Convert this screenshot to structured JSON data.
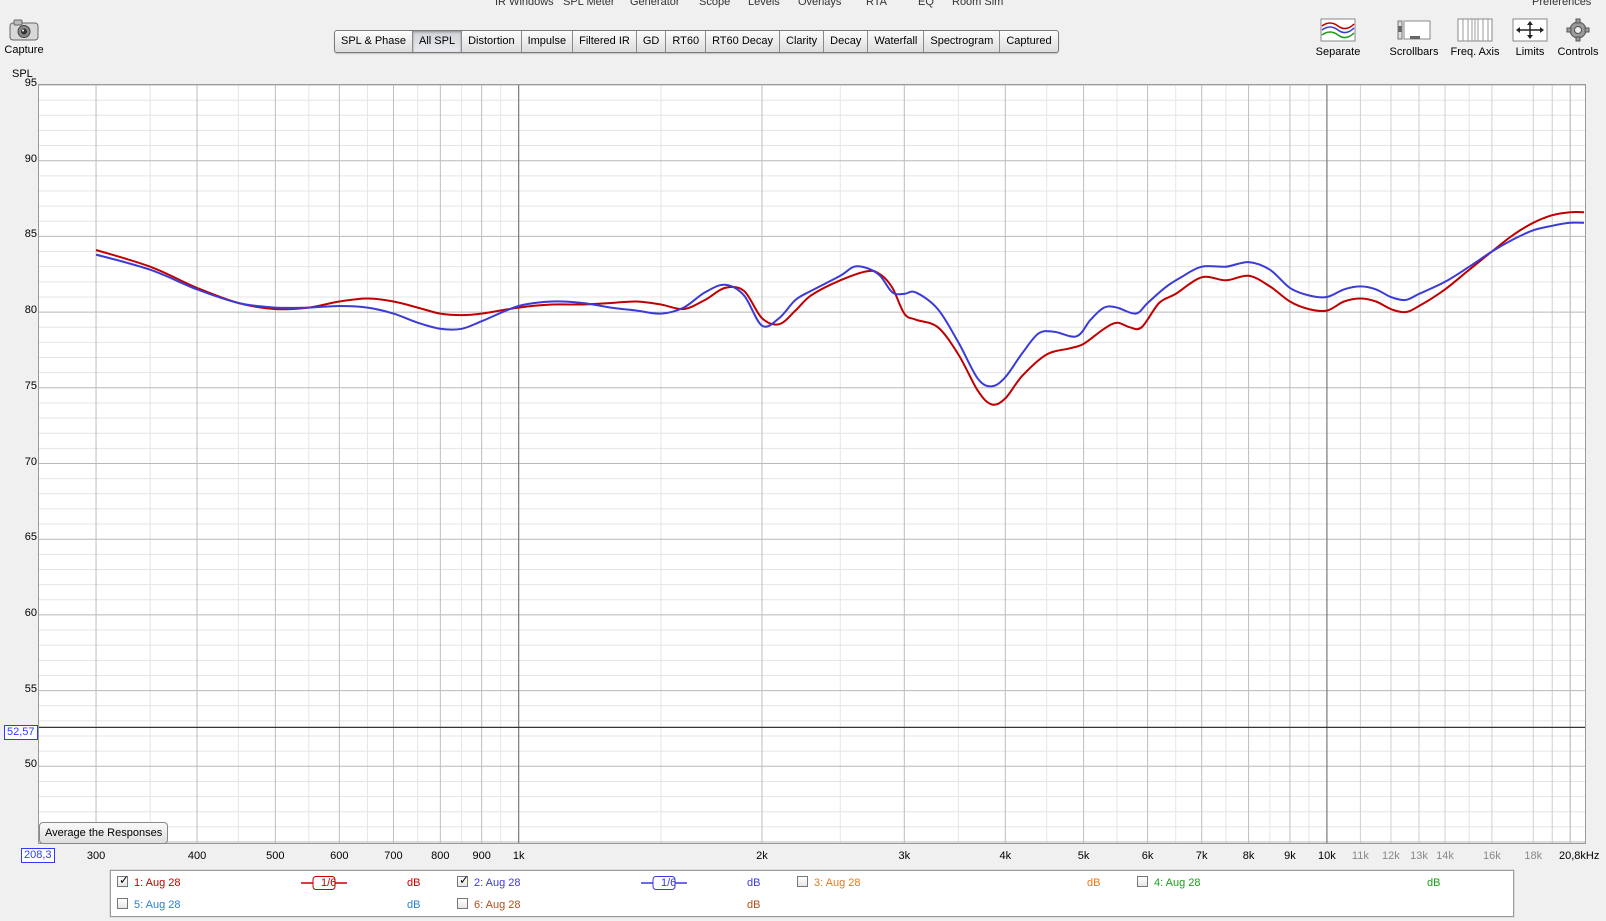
{
  "top_menu": [
    "IR Windows",
    "SPL Meter",
    "Generator",
    "Scope",
    "Levels",
    "Overlays",
    "RTA",
    "EQ",
    "Room Sim",
    "Preferences"
  ],
  "capture": {
    "label": "Capture"
  },
  "tabs": [
    {
      "label": "SPL & Phase",
      "active": false
    },
    {
      "label": "All SPL",
      "active": true
    },
    {
      "label": "Distortion",
      "active": false
    },
    {
      "label": "Impulse",
      "active": false
    },
    {
      "label": "Filtered IR",
      "active": false
    },
    {
      "label": "GD",
      "active": false
    },
    {
      "label": "RT60",
      "active": false
    },
    {
      "label": "RT60 Decay",
      "active": false
    },
    {
      "label": "Clarity",
      "active": false
    },
    {
      "label": "Decay",
      "active": false
    },
    {
      "label": "Waterfall",
      "active": false
    },
    {
      "label": "Spectrogram",
      "active": false
    },
    {
      "label": "Captured",
      "active": false
    }
  ],
  "right_tools": [
    {
      "label": "Separate",
      "icon": "separate-icon"
    },
    {
      "label": "Scrollbars",
      "icon": "scrollbars-icon"
    },
    {
      "label": "Freq. Axis",
      "icon": "freq-axis-icon"
    },
    {
      "label": "Limits",
      "icon": "limits-icon"
    },
    {
      "label": "Controls",
      "icon": "gear-icon"
    }
  ],
  "avg_button": "Average the Responses",
  "cursor": {
    "y_value": "52,57",
    "x_value": "208,3",
    "y_numeric": 52.57
  },
  "chart_data": {
    "type": "line",
    "ylabel": "SPL",
    "xscale": "log",
    "xlim": [
      255,
      20800
    ],
    "ylim": [
      45,
      95
    ],
    "y_ticks": [
      95,
      90,
      85,
      80,
      75,
      70,
      65,
      60,
      55,
      50
    ],
    "x_ticks": [
      {
        "v": 300,
        "t": "300",
        "minor": false
      },
      {
        "v": 400,
        "t": "400",
        "minor": false
      },
      {
        "v": 500,
        "t": "500",
        "minor": false
      },
      {
        "v": 600,
        "t": "600",
        "minor": false
      },
      {
        "v": 700,
        "t": "700",
        "minor": false
      },
      {
        "v": 800,
        "t": "800",
        "minor": false
      },
      {
        "v": 900,
        "t": "900",
        "minor": false
      },
      {
        "v": 1000,
        "t": "1k",
        "minor": false
      },
      {
        "v": 2000,
        "t": "2k",
        "minor": false
      },
      {
        "v": 3000,
        "t": "3k",
        "minor": false
      },
      {
        "v": 4000,
        "t": "4k",
        "minor": false
      },
      {
        "v": 5000,
        "t": "5k",
        "minor": false
      },
      {
        "v": 6000,
        "t": "6k",
        "minor": false
      },
      {
        "v": 7000,
        "t": "7k",
        "minor": false
      },
      {
        "v": 8000,
        "t": "8k",
        "minor": false
      },
      {
        "v": 9000,
        "t": "9k",
        "minor": false
      },
      {
        "v": 10000,
        "t": "10k",
        "minor": false
      },
      {
        "v": 11000,
        "t": "11k",
        "minor": true
      },
      {
        "v": 12000,
        "t": "12k",
        "minor": true
      },
      {
        "v": 13000,
        "t": "13k",
        "minor": true
      },
      {
        "v": 14000,
        "t": "14k",
        "minor": true
      },
      {
        "v": 16000,
        "t": "16k",
        "minor": true
      },
      {
        "v": 18000,
        "t": "18k",
        "minor": true
      },
      {
        "v": 20800,
        "t": "20,8kHz",
        "minor": false
      }
    ],
    "series": [
      {
        "name": "1: Aug 28",
        "color": "#c00000",
        "points": [
          [
            300,
            84.1
          ],
          [
            350,
            83.0
          ],
          [
            400,
            81.6
          ],
          [
            450,
            80.6
          ],
          [
            500,
            80.2
          ],
          [
            550,
            80.3
          ],
          [
            600,
            80.7
          ],
          [
            650,
            80.9
          ],
          [
            700,
            80.7
          ],
          [
            750,
            80.3
          ],
          [
            800,
            79.9
          ],
          [
            850,
            79.8
          ],
          [
            900,
            79.9
          ],
          [
            1000,
            80.3
          ],
          [
            1100,
            80.5
          ],
          [
            1200,
            80.5
          ],
          [
            1300,
            80.6
          ],
          [
            1400,
            80.7
          ],
          [
            1500,
            80.5
          ],
          [
            1600,
            80.2
          ],
          [
            1700,
            80.8
          ],
          [
            1800,
            81.6
          ],
          [
            1900,
            81.4
          ],
          [
            2000,
            79.6
          ],
          [
            2100,
            79.2
          ],
          [
            2200,
            80.1
          ],
          [
            2300,
            81.1
          ],
          [
            2500,
            82.1
          ],
          [
            2700,
            82.7
          ],
          [
            2800,
            82.5
          ],
          [
            2900,
            81.6
          ],
          [
            3000,
            79.9
          ],
          [
            3100,
            79.5
          ],
          [
            3300,
            79.0
          ],
          [
            3500,
            77.2
          ],
          [
            3700,
            74.8
          ],
          [
            3850,
            73.9
          ],
          [
            4000,
            74.3
          ],
          [
            4200,
            75.8
          ],
          [
            4500,
            77.2
          ],
          [
            4800,
            77.6
          ],
          [
            5000,
            77.9
          ],
          [
            5300,
            78.9
          ],
          [
            5500,
            79.3
          ],
          [
            5700,
            79.0
          ],
          [
            5900,
            79.0
          ],
          [
            6200,
            80.6
          ],
          [
            6500,
            81.2
          ],
          [
            7000,
            82.3
          ],
          [
            7500,
            82.1
          ],
          [
            8000,
            82.4
          ],
          [
            8500,
            81.7
          ],
          [
            9000,
            80.7
          ],
          [
            9500,
            80.2
          ],
          [
            10000,
            80.1
          ],
          [
            10500,
            80.7
          ],
          [
            11000,
            80.9
          ],
          [
            11500,
            80.7
          ],
          [
            12000,
            80.2
          ],
          [
            12500,
            80.0
          ],
          [
            13000,
            80.4
          ],
          [
            14000,
            81.5
          ],
          [
            15000,
            82.8
          ],
          [
            16000,
            84.0
          ],
          [
            17000,
            85.1
          ],
          [
            18000,
            85.9
          ],
          [
            19000,
            86.4
          ],
          [
            20000,
            86.6
          ],
          [
            20800,
            86.6
          ]
        ]
      },
      {
        "name": "2: Aug 28",
        "color": "#3b3bd6",
        "points": [
          [
            300,
            83.8
          ],
          [
            350,
            82.8
          ],
          [
            400,
            81.5
          ],
          [
            450,
            80.6
          ],
          [
            500,
            80.3
          ],
          [
            550,
            80.3
          ],
          [
            600,
            80.4
          ],
          [
            650,
            80.3
          ],
          [
            700,
            79.9
          ],
          [
            750,
            79.3
          ],
          [
            800,
            78.9
          ],
          [
            850,
            78.9
          ],
          [
            900,
            79.4
          ],
          [
            1000,
            80.4
          ],
          [
            1100,
            80.7
          ],
          [
            1200,
            80.6
          ],
          [
            1300,
            80.3
          ],
          [
            1400,
            80.1
          ],
          [
            1500,
            79.9
          ],
          [
            1600,
            80.3
          ],
          [
            1700,
            81.3
          ],
          [
            1800,
            81.8
          ],
          [
            1900,
            81.1
          ],
          [
            2000,
            79.1
          ],
          [
            2100,
            79.6
          ],
          [
            2200,
            80.8
          ],
          [
            2300,
            81.4
          ],
          [
            2500,
            82.4
          ],
          [
            2600,
            83.0
          ],
          [
            2700,
            82.9
          ],
          [
            2800,
            82.4
          ],
          [
            2900,
            81.3
          ],
          [
            3000,
            81.2
          ],
          [
            3100,
            81.3
          ],
          [
            3300,
            80.2
          ],
          [
            3500,
            78.0
          ],
          [
            3700,
            75.6
          ],
          [
            3850,
            75.1
          ],
          [
            4000,
            75.7
          ],
          [
            4200,
            77.3
          ],
          [
            4400,
            78.6
          ],
          [
            4600,
            78.7
          ],
          [
            4900,
            78.4
          ],
          [
            5100,
            79.5
          ],
          [
            5300,
            80.3
          ],
          [
            5500,
            80.3
          ],
          [
            5800,
            79.9
          ],
          [
            6000,
            80.6
          ],
          [
            6300,
            81.6
          ],
          [
            6600,
            82.3
          ],
          [
            7000,
            83.0
          ],
          [
            7500,
            83.0
          ],
          [
            8000,
            83.3
          ],
          [
            8500,
            82.8
          ],
          [
            9000,
            81.6
          ],
          [
            9500,
            81.1
          ],
          [
            10000,
            81.0
          ],
          [
            10500,
            81.5
          ],
          [
            11000,
            81.7
          ],
          [
            11500,
            81.5
          ],
          [
            12000,
            81.0
          ],
          [
            12500,
            80.8
          ],
          [
            13000,
            81.2
          ],
          [
            14000,
            82.0
          ],
          [
            15000,
            83.0
          ],
          [
            16000,
            84.0
          ],
          [
            17000,
            84.8
          ],
          [
            18000,
            85.4
          ],
          [
            19000,
            85.7
          ],
          [
            20000,
            85.9
          ],
          [
            20800,
            85.9
          ]
        ]
      }
    ]
  },
  "legend": [
    {
      "label": "1: Aug 28",
      "checked": true,
      "color": "#c00000",
      "smoothing": "1/6",
      "unit": "dB"
    },
    {
      "label": "2: Aug 28",
      "checked": true,
      "color": "#3b3bd6",
      "smoothing": "1/6",
      "unit": "dB"
    },
    {
      "label": "3: Aug 28",
      "checked": false,
      "color": "#e07b20",
      "smoothing": "",
      "unit": "dB"
    },
    {
      "label": "4: Aug 28",
      "checked": false,
      "color": "#1a9e1a",
      "smoothing": "",
      "unit": "dB"
    },
    {
      "label": "5: Aug 28",
      "checked": false,
      "color": "#2a7fd4",
      "smoothing": "",
      "unit": "dB"
    },
    {
      "label": "6: Aug 28",
      "checked": false,
      "color": "#b0501a",
      "smoothing": "",
      "unit": "dB"
    }
  ]
}
